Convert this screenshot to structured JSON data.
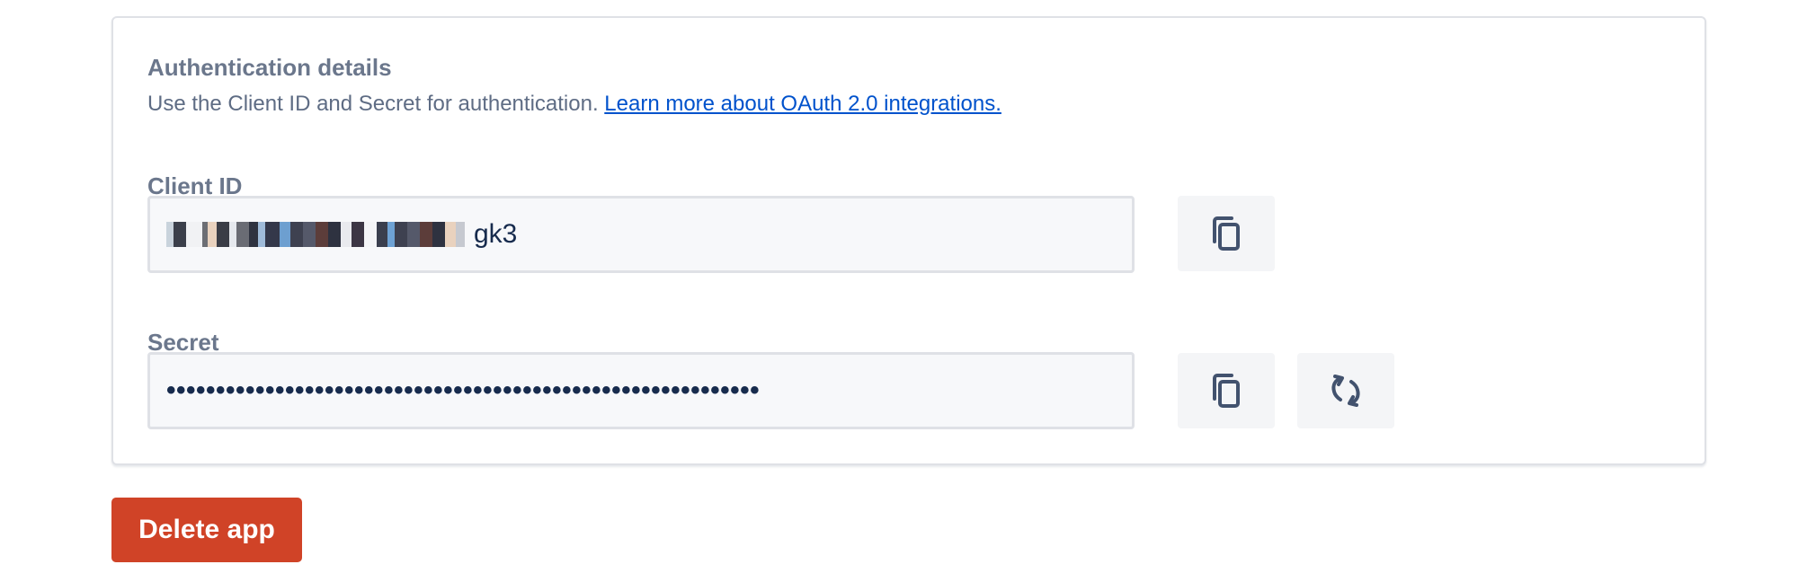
{
  "auth": {
    "title": "Authentication details",
    "description": "Use the Client ID and Secret for authentication.",
    "link_text": "Learn more about OAuth 2.0 integrations."
  },
  "client_id": {
    "label": "Client ID",
    "visible_suffix": "gk3"
  },
  "secret": {
    "label": "Secret",
    "masked_value": "••••••••••••••••••••••••••••••••••••••••••••••••••••••••••••"
  },
  "icons": {
    "copy": "copy-icon",
    "regenerate": "refresh-icon"
  },
  "actions": {
    "delete_label": "Delete app"
  },
  "colors": {
    "danger": "#d04327",
    "link": "#0052cc",
    "label": "#6b778c",
    "text": "#172b4d"
  }
}
